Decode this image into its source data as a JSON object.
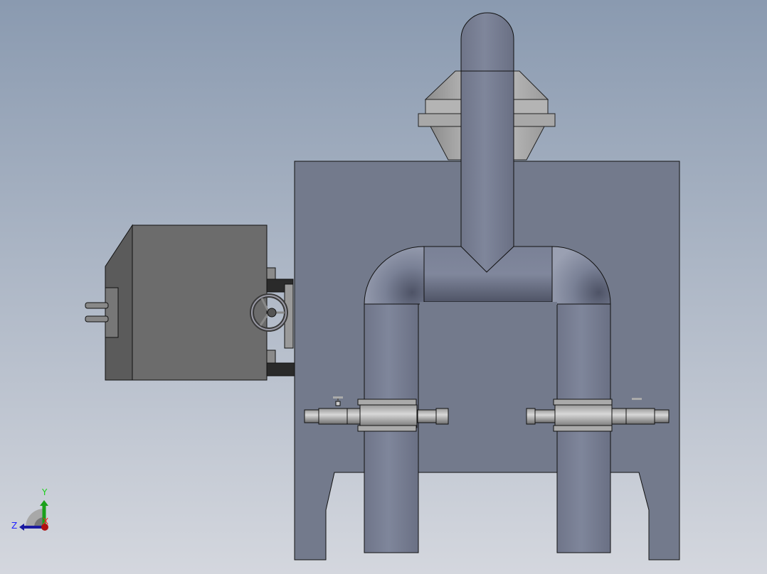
{
  "viewport": {
    "background_top": "#8a9ab0",
    "background_bottom": "#d4d7de",
    "body_color": "#737a8c",
    "pipe_color": "#7a8196",
    "box_color": "#6c6c6c"
  },
  "triad": {
    "y_label": "Y",
    "z_label": "Z",
    "x_label": "X",
    "y_color": "#1aa01a",
    "z_color": "#1a1aa0",
    "x_color": "#c00000"
  }
}
